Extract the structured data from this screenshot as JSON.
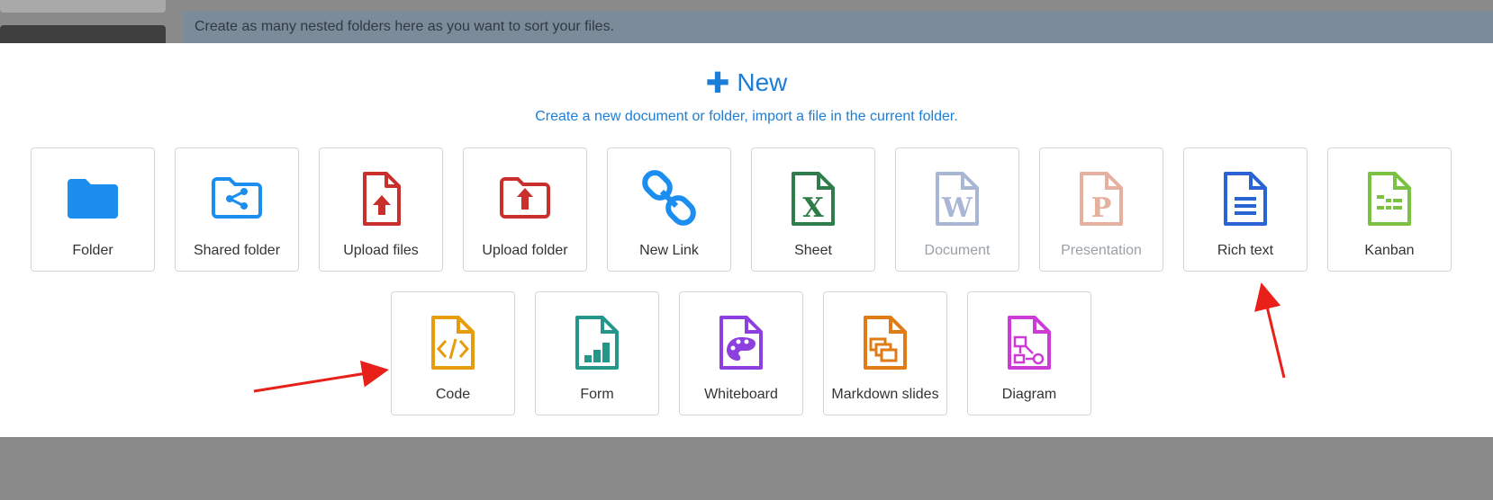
{
  "background": {
    "info_text": "Create as many nested folders here as you want to sort your files."
  },
  "modal": {
    "title": "New",
    "subtitle": "Create a new document or folder, import a file in the current folder."
  },
  "items_row1": [
    {
      "label": "Folder",
      "icon": "folder-icon",
      "color": "#1c8ef0",
      "disabled": false
    },
    {
      "label": "Shared folder",
      "icon": "shared-folder-icon",
      "color": "#1c8ef0",
      "disabled": false
    },
    {
      "label": "Upload files",
      "icon": "upload-file-icon",
      "color": "#c9302c",
      "disabled": false
    },
    {
      "label": "Upload folder",
      "icon": "upload-folder-icon",
      "color": "#c9302c",
      "disabled": false
    },
    {
      "label": "New Link",
      "icon": "link-icon",
      "color": "#1c8ef0",
      "disabled": false
    },
    {
      "label": "Sheet",
      "icon": "sheet-icon",
      "color": "#2e7d4a",
      "disabled": false
    },
    {
      "label": "Document",
      "icon": "document-icon",
      "color": "#a9b6d6",
      "disabled": true
    },
    {
      "label": "Presentation",
      "icon": "presentation-icon",
      "color": "#e6b09f",
      "disabled": true
    },
    {
      "label": "Rich text",
      "icon": "rich-text-icon",
      "color": "#2a63d4",
      "disabled": false
    },
    {
      "label": "Kanban",
      "icon": "kanban-icon",
      "color": "#7bc142",
      "disabled": false
    }
  ],
  "items_row2": [
    {
      "label": "Code",
      "icon": "code-icon",
      "color": "#e69c0c",
      "disabled": false
    },
    {
      "label": "Form",
      "icon": "form-icon",
      "color": "#24978a",
      "disabled": false
    },
    {
      "label": "Whiteboard",
      "icon": "whiteboard-icon",
      "color": "#8d3fe0",
      "disabled": false
    },
    {
      "label": "Markdown slides",
      "icon": "markdown-slides-icon",
      "color": "#e07b15",
      "disabled": false
    },
    {
      "label": "Diagram",
      "icon": "diagram-icon",
      "color": "#cc3bd6",
      "disabled": false
    }
  ],
  "annotation_color": "#e8201a"
}
